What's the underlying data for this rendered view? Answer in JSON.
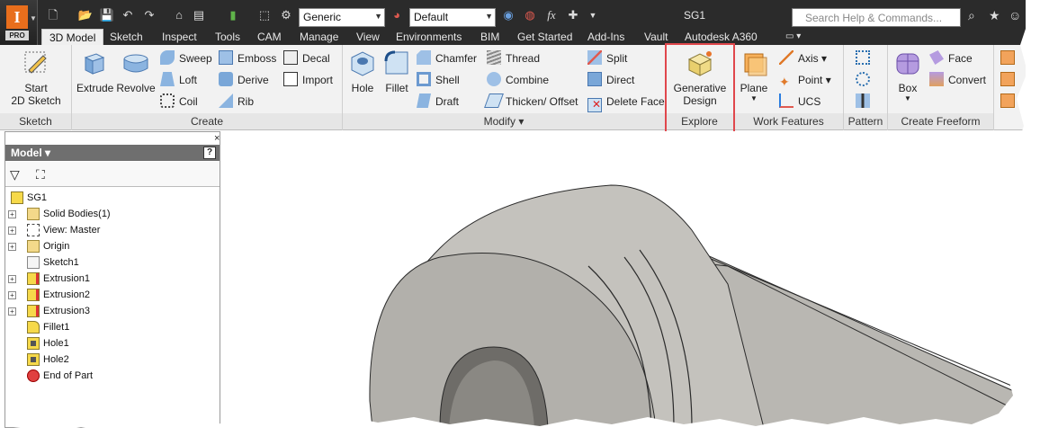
{
  "app": {
    "badge": "PRO",
    "logo_letter": "I"
  },
  "qat": {
    "material": "Generic",
    "appearance": "Default",
    "fx": "fx"
  },
  "doc_title": "SG1",
  "search_placeholder": "Search Help & Commands...",
  "tabs": [
    "3D Model",
    "Sketch",
    "Inspect",
    "Tools",
    "CAM",
    "Manage",
    "View",
    "Environments",
    "BIM",
    "Get Started",
    "Add-Ins",
    "Vault",
    "Autodesk A360"
  ],
  "ribbon": {
    "sketch": {
      "start_line1": "Start",
      "start_line2": "2D Sketch",
      "panel": "Sketch"
    },
    "create": {
      "extrude": "Extrude",
      "revolve": "Revolve",
      "sweep": "Sweep",
      "loft": "Loft",
      "coil": "Coil",
      "emboss": "Emboss",
      "derive": "Derive",
      "rib": "Rib",
      "decal": "Decal",
      "import": "Import",
      "panel": "Create"
    },
    "modify": {
      "hole": "Hole",
      "fillet": "Fillet",
      "chamfer": "Chamfer",
      "shell": "Shell",
      "draft": "Draft",
      "thread": "Thread",
      "combine": "Combine",
      "thicken": "Thicken/ Offset",
      "split": "Split",
      "direct": "Direct",
      "delete_face": "Delete Face",
      "panel": "Modify ▾"
    },
    "explore": {
      "gen_line1": "Generative",
      "gen_line2": "Design",
      "panel": "Explore"
    },
    "work": {
      "plane": "Plane",
      "axis": "Axis",
      "point": "Point",
      "ucs": "UCS",
      "panel": "Work Features"
    },
    "pattern": {
      "panel": "Pattern"
    },
    "freeform": {
      "box": "Box",
      "face": "Face",
      "convert": "Convert",
      "panel": "Create Freeform"
    }
  },
  "browser": {
    "title": "Model ▾",
    "help": "?",
    "close": "×",
    "items": [
      {
        "label": "SG1",
        "icon": "part-icon"
      },
      {
        "label": "Solid Bodies(1)",
        "icon": "folder-icon"
      },
      {
        "label": "View: Master",
        "icon": "view-icon"
      },
      {
        "label": "Origin",
        "icon": "folder-icon"
      },
      {
        "label": "Sketch1",
        "icon": "sketch-icon"
      },
      {
        "label": "Extrusion1",
        "icon": "extrusion-icon"
      },
      {
        "label": "Extrusion2",
        "icon": "extrusion-icon"
      },
      {
        "label": "Extrusion3",
        "icon": "extrusion-icon"
      },
      {
        "label": "Fillet1",
        "icon": "fillet-icon"
      },
      {
        "label": "Hole1",
        "icon": "hole-icon"
      },
      {
        "label": "Hole2",
        "icon": "hole-icon"
      },
      {
        "label": "End of Part",
        "icon": "end-of-part-icon"
      }
    ]
  },
  "colors": {
    "accent_highlight": "#e0474c",
    "titlebar": "#2b2b2b",
    "model_gray": "#b4b2ad"
  }
}
